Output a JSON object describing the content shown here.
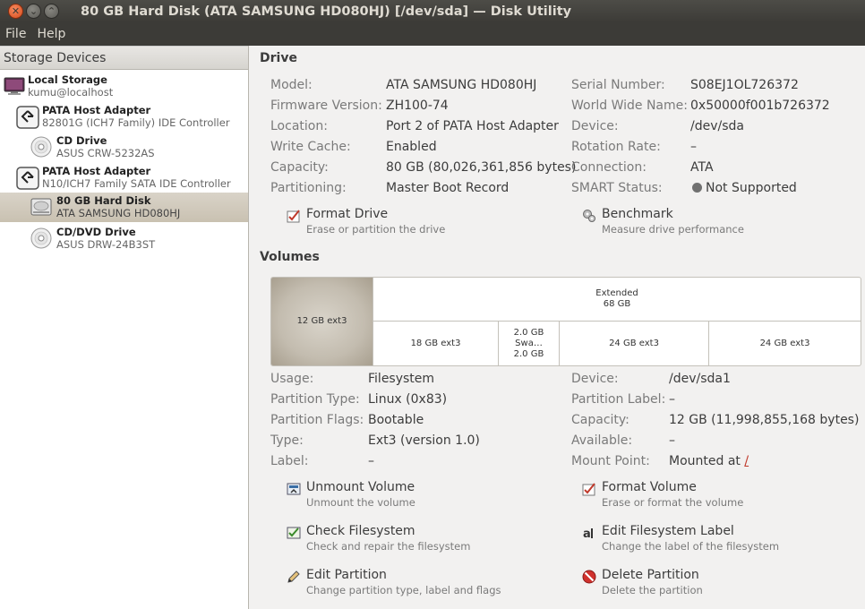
{
  "window": {
    "title": "80 GB Hard Disk (ATA SAMSUNG HD080HJ) [/dev/sda] — Disk Utility"
  },
  "menubar": {
    "items": [
      "File",
      "Help"
    ]
  },
  "sidebar": {
    "header": "Storage Devices",
    "items": [
      {
        "name": "Local Storage",
        "sub": "kumu@localhost",
        "icon": "computer-icon"
      },
      {
        "name": "PATA Host Adapter",
        "sub": "82801G (ICH7 Family) IDE Controller",
        "icon": "host-adapter-icon"
      },
      {
        "name": "CD Drive",
        "sub": "ASUS CRW-5232AS",
        "icon": "optical-disc-icon"
      },
      {
        "name": "PATA Host Adapter",
        "sub": "N10/ICH7 Family SATA IDE Controller",
        "icon": "host-adapter-icon"
      },
      {
        "name": "80 GB Hard Disk",
        "sub": "ATA SAMSUNG HD080HJ",
        "icon": "hard-disk-icon",
        "selected": true
      },
      {
        "name": "CD/DVD Drive",
        "sub": "ASUS DRW-24B3ST",
        "icon": "optical-disc-icon"
      }
    ]
  },
  "drive": {
    "title": "Drive",
    "left": [
      {
        "label": "Model:",
        "value": "ATA SAMSUNG HD080HJ"
      },
      {
        "label": "Firmware Version:",
        "value": "ZH100-74"
      },
      {
        "label": "Location:",
        "value": "Port 2 of PATA Host Adapter"
      },
      {
        "label": "Write Cache:",
        "value": "Enabled"
      },
      {
        "label": "Capacity:",
        "value": "80 GB (80,026,361,856 bytes)"
      },
      {
        "label": "Partitioning:",
        "value": "Master Boot Record"
      }
    ],
    "right": [
      {
        "label": "Serial Number:",
        "value": "S08EJ1OL726372"
      },
      {
        "label": "World Wide Name:",
        "value": "0x50000f001b726372"
      },
      {
        "label": "Device:",
        "value": "/dev/sda"
      },
      {
        "label": "Rotation Rate:",
        "value": "–"
      },
      {
        "label": "Connection:",
        "value": "ATA"
      },
      {
        "label": "SMART Status:",
        "value": "Not Supported"
      }
    ],
    "actions": [
      {
        "title": "Format Drive",
        "desc": "Erase or partition the drive",
        "icon": "format-icon"
      },
      {
        "title": "Benchmark",
        "desc": "Measure drive performance",
        "icon": "benchmark-icon"
      }
    ]
  },
  "volumes": {
    "title": "Volumes",
    "graph": {
      "selected": "12 GB ext3",
      "extended_title": "Extended",
      "extended_size": "68 GB",
      "parts": [
        "18 GB ext3",
        "2.0 GB Swa…",
        "2.0 GB",
        "24 GB ext3",
        "24 GB ext3"
      ]
    },
    "left": [
      {
        "label": "Usage:",
        "value": "Filesystem"
      },
      {
        "label": "Partition Type:",
        "value": "Linux (0x83)"
      },
      {
        "label": "Partition Flags:",
        "value": "Bootable"
      },
      {
        "label": "Type:",
        "value": "Ext3 (version 1.0)"
      },
      {
        "label": "Label:",
        "value": "–"
      }
    ],
    "right": [
      {
        "label": "Device:",
        "value": "/dev/sda1"
      },
      {
        "label": "Partition Label:",
        "value": "–"
      },
      {
        "label": "Capacity:",
        "value": "12 GB (11,998,855,168 bytes)"
      },
      {
        "label": "Available:",
        "value": "–"
      },
      {
        "label": "Mount Point:",
        "value": "Mounted at",
        "link": "/"
      }
    ],
    "actions": [
      {
        "title": "Unmount Volume",
        "desc": "Unmount the volume",
        "icon": "unmount-icon"
      },
      {
        "title": "Format Volume",
        "desc": "Erase or format the volume",
        "icon": "format-icon"
      },
      {
        "title": "Check Filesystem",
        "desc": "Check and repair the filesystem",
        "icon": "check-icon"
      },
      {
        "title": "Edit Filesystem Label",
        "desc": "Change the label of the filesystem",
        "icon": "label-icon"
      },
      {
        "title": "Edit Partition",
        "desc": "Change partition type, label and flags",
        "icon": "edit-icon"
      },
      {
        "title": "Delete Partition",
        "desc": "Delete the partition",
        "icon": "delete-icon"
      }
    ]
  }
}
